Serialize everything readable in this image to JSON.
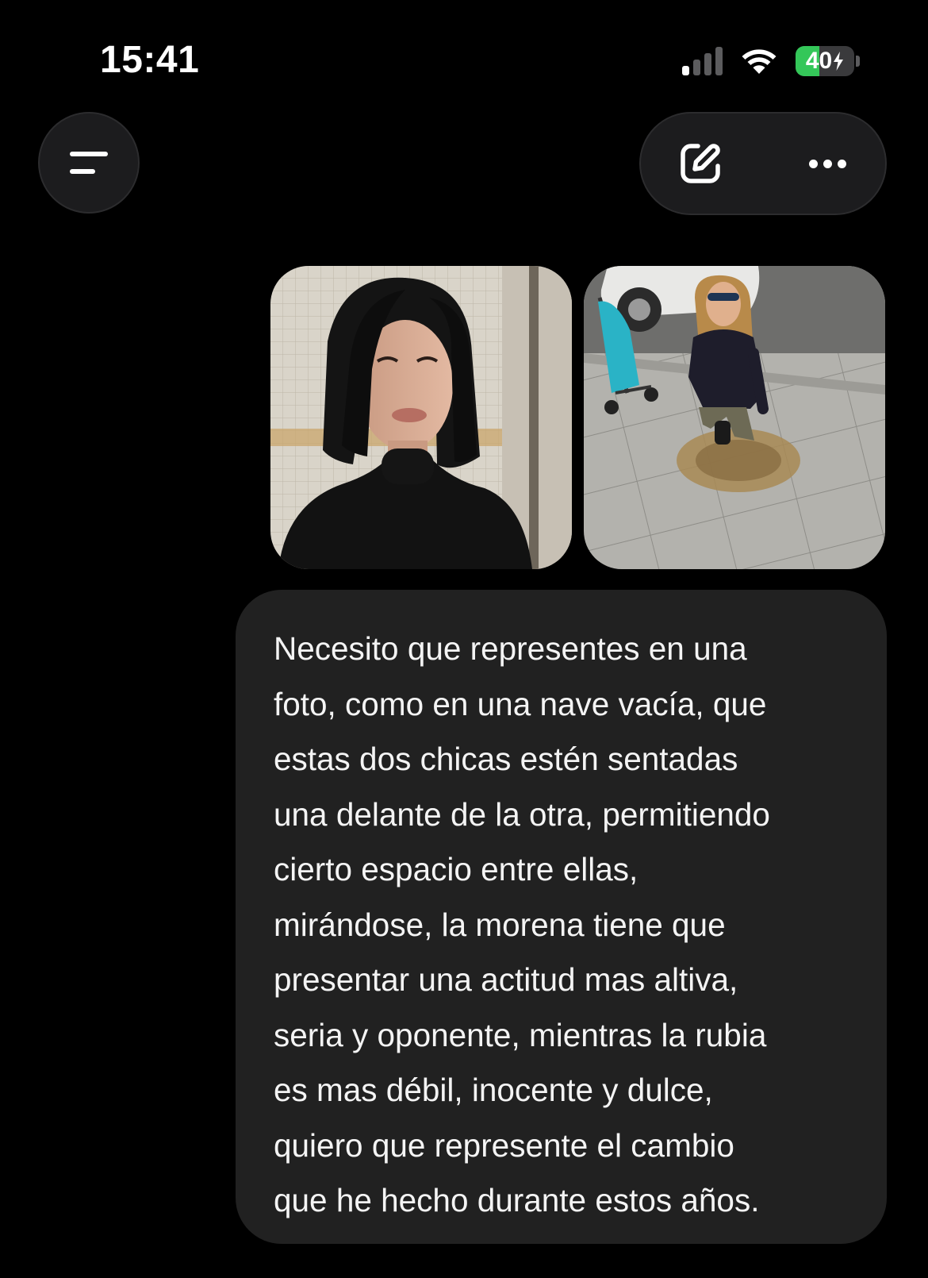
{
  "status_bar": {
    "time": "15:41",
    "signal_bars_active": 1,
    "signal_bars_total": 4,
    "wifi_icon": "wifi-icon",
    "battery_level_label": "40",
    "battery_level_fraction": 0.4,
    "battery_charging": true,
    "battery_color": "#34c759"
  },
  "toolbar": {
    "menu_icon": "menu-icon",
    "edit_icon": "new-chat-edit-icon",
    "more_icon": "more-options-icon"
  },
  "attachments": [
    {
      "kind": "photo",
      "subject": "brunette-woman-portrait"
    },
    {
      "kind": "photo",
      "subject": "blonde-woman-street"
    }
  ],
  "message": {
    "role": "user",
    "text": "Necesito que representes en una\nfoto, como en una nave vacía, que\nestas dos chicas estén sentadas\nuna delante de la otra, permitiendo\ncierto espacio entre ellas,\nmirándose, la morena tiene que\npresentar una actitud mas altiva,\nseria y oponente, mientras la rubia\nes mas débil, inocente y dulce,\nquiero que represente el cambio\nque he hecho durante estos años."
  },
  "colors": {
    "background": "#000000",
    "bubble": "#212121",
    "button": "#1c1c1e"
  }
}
